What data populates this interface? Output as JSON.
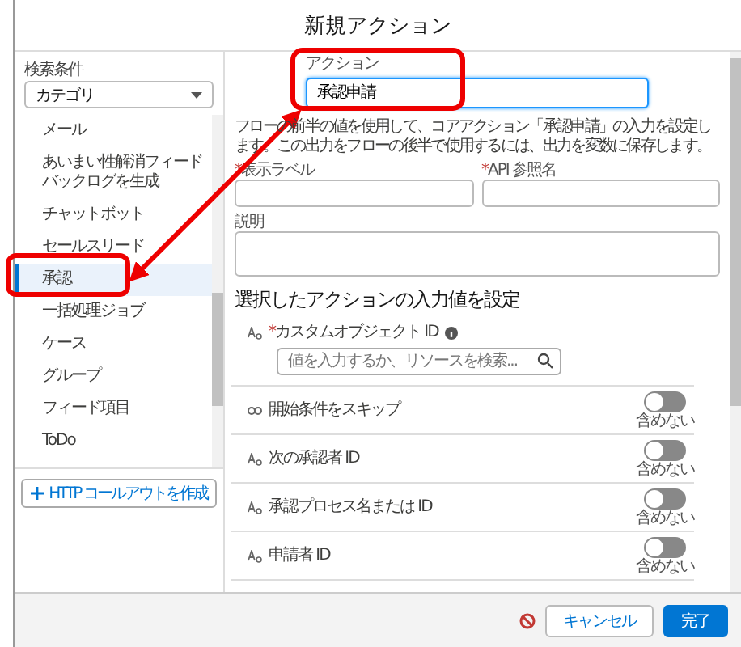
{
  "dialog": {
    "title": "新規アクション"
  },
  "sidebar": {
    "filter_label": "検索条件",
    "filter_value": "カテゴリ",
    "items": [
      {
        "label": "メール",
        "selected": false
      },
      {
        "label": "あいまい性解消フィードバックログを生成",
        "selected": false
      },
      {
        "label": "チャットボット",
        "selected": false
      },
      {
        "label": "セールスリード",
        "selected": false
      },
      {
        "label": "承認",
        "selected": true
      },
      {
        "label": "一括処理ジョブ",
        "selected": false
      },
      {
        "label": "ケース",
        "selected": false
      },
      {
        "label": "グループ",
        "selected": false
      },
      {
        "label": "フィード項目",
        "selected": false
      },
      {
        "label": "ToDo",
        "selected": false
      }
    ],
    "create_button": "HTTP コールアウトを作成"
  },
  "form": {
    "required_mark": "*",
    "action_label": "アクション",
    "action_value": "承認申請",
    "description": "フローの前半の値を使用して、コアアクション「承認申請」の入力を設定します。この出力をフローの後半で使用するには、出力を変数に保存します。",
    "fields": [
      {
        "label": "表示ラベル",
        "required": true
      },
      {
        "label": "API 参照名",
        "required": true
      }
    ],
    "notes_label": "説明",
    "inputs_heading": "選択したアクションの入力値を設定",
    "inputs": [
      {
        "kind": "lookup",
        "label": "カスタムオブジェクト ID",
        "required": true,
        "placeholder": "値を入力するか、リソースを検索..."
      },
      {
        "kind": "toggle",
        "label": "開始条件をスキップ",
        "on": false,
        "caption": "含めない"
      },
      {
        "kind": "toggle",
        "label": "次の承認者 ID",
        "on": false,
        "caption": "含めない"
      },
      {
        "kind": "toggle",
        "label": "承認プロセス名または ID",
        "on": false,
        "caption": "含めない"
      },
      {
        "kind": "toggle",
        "label": "申請者 ID",
        "on": false,
        "caption": "含めない"
      }
    ]
  },
  "footer": {
    "buttons": [
      "キャンセル",
      "完了"
    ]
  }
}
